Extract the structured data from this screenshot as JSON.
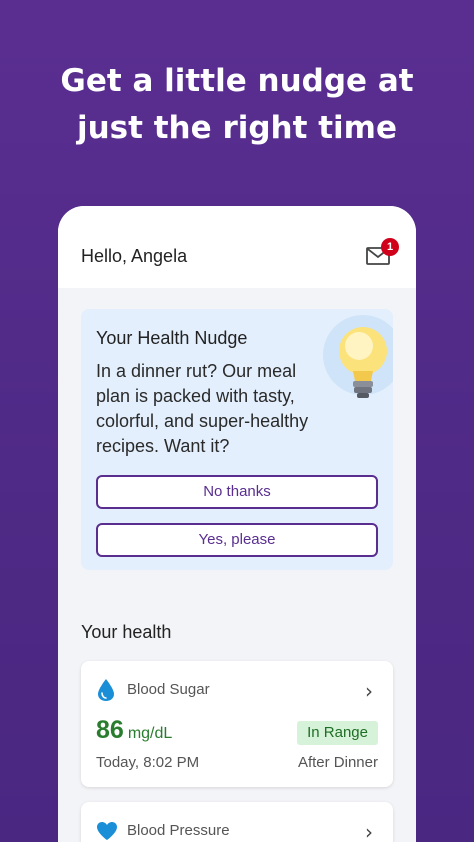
{
  "headline": {
    "line1": "Get a little nudge at",
    "line2": "just the right time"
  },
  "header": {
    "greeting": "Hello, Angela",
    "mail_icon": "envelope-icon",
    "mail_badge": "1"
  },
  "nudge": {
    "title": "Your Health Nudge",
    "body": "In a dinner rut? Our meal plan is packed with tasty, colorful, and super-healthy recipes. Want it?",
    "icon": "lightbulb-icon",
    "decline_label": "No thanks",
    "accept_label": "Yes, please"
  },
  "health": {
    "section_title": "Your health",
    "blood_sugar": {
      "label": "Blood Sugar",
      "icon": "drop-icon",
      "value": "86",
      "unit": "mg/dL",
      "status": "In Range",
      "time": "Today, 8:02 PM",
      "context": "After Dinner"
    },
    "blood_pressure": {
      "label": "Blood Pressure",
      "icon": "heart-icon"
    }
  },
  "colors": {
    "brand_purple": "#5a2e91",
    "nudge_background": "#e3effc",
    "in_range_green": "#2a7d2e",
    "badge_red": "#d0021b",
    "icon_blue": "#1a8fd8"
  }
}
